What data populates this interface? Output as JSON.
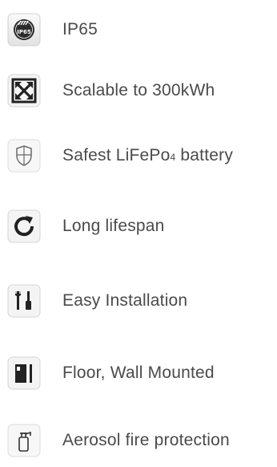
{
  "features": [
    {
      "label": "IP65",
      "icon": "ip65-badge-icon"
    },
    {
      "label": "Scalable to 300kWh",
      "icon": "expand-arrows-icon"
    },
    {
      "label_prefix": "Safest LiFePo",
      "label_sub": "4",
      "label_suffix": " battery",
      "icon": "shield-icon"
    },
    {
      "label": "Long lifespan",
      "icon": "refresh-arrow-icon"
    },
    {
      "label": "Easy Installation",
      "icon": "tools-icon"
    },
    {
      "label": "Floor, Wall Mounted",
      "icon": "wall-mount-icon"
    },
    {
      "label": "Aerosol fire protection",
      "icon": "fire-extinguisher-icon"
    }
  ],
  "colors": {
    "text": "#4a4a4a",
    "icon_dark": "#2b2b2b",
    "icon_tile_bg": "#f2f2f2"
  }
}
